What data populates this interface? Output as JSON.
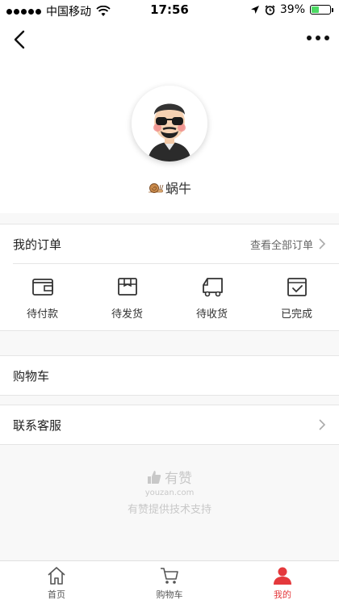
{
  "status_bar": {
    "carrier": "中国移动",
    "time": "17:56",
    "battery": "39%",
    "battery_level": 0.39
  },
  "profile": {
    "nickname": "蜗牛"
  },
  "orders": {
    "title": "我的订单",
    "view_all": "查看全部订单",
    "statuses": [
      {
        "label": "待付款",
        "icon": "wallet-icon"
      },
      {
        "label": "待发货",
        "icon": "package-icon"
      },
      {
        "label": "待收货",
        "icon": "truck-icon"
      },
      {
        "label": "已完成",
        "icon": "completed-icon"
      }
    ]
  },
  "cart_row": {
    "label": "购物车"
  },
  "contact_row": {
    "label": "联系客服"
  },
  "brand": {
    "name": "有赞",
    "site": "youzan.com",
    "tagline": "有赞提供技术支持"
  },
  "tabbar": {
    "items": [
      {
        "label": "首页",
        "icon": "home-icon"
      },
      {
        "label": "购物车",
        "icon": "cart-icon"
      },
      {
        "label": "我的",
        "icon": "user-icon",
        "active": true
      }
    ]
  },
  "colors": {
    "accent": "#e4393c",
    "background": "#f8f8f8"
  }
}
